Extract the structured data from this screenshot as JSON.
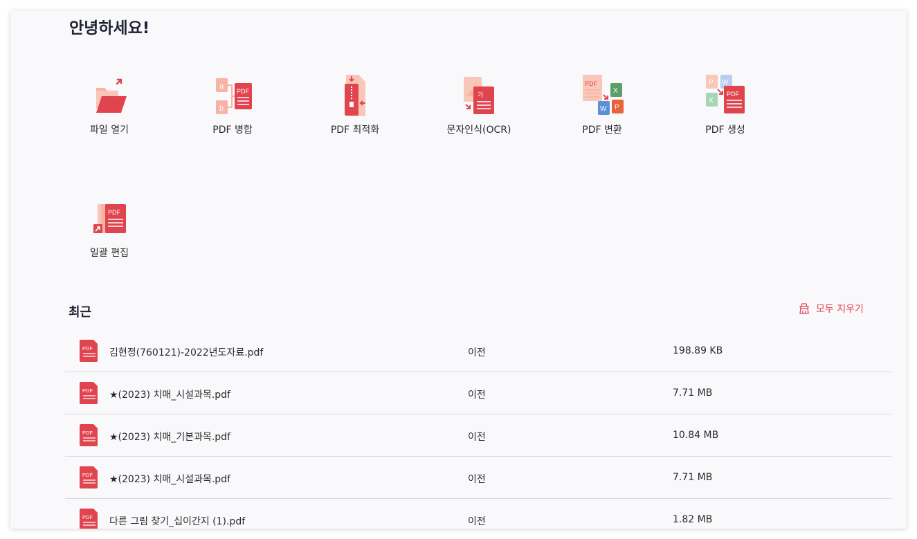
{
  "greeting": "안녕하세요!",
  "colors": {
    "accent": "#e0454f",
    "accent_light": "#f7b3a3",
    "text": "#2a2a2a"
  },
  "tools": [
    {
      "label": "파일 열기",
      "icon": "folder-open-icon"
    },
    {
      "label": "PDF 병합",
      "icon": "pdf-merge-icon"
    },
    {
      "label": "PDF 최적화",
      "icon": "pdf-compress-icon"
    },
    {
      "label": "문자인식(OCR)",
      "icon": "ocr-icon"
    },
    {
      "label": "PDF 변환",
      "icon": "pdf-convert-icon"
    },
    {
      "label": "PDF 생성",
      "icon": "pdf-create-icon"
    },
    {
      "label": "일괄 편집",
      "icon": "batch-edit-icon"
    }
  ],
  "recent": {
    "title": "최근",
    "clear_label": "모두 지우기",
    "files": [
      {
        "name": "김현정(760121)-2022년도자료.pdf",
        "date": "이전",
        "size": "198.89 KB"
      },
      {
        "name": "★(2023) 치매_시설과목.pdf",
        "date": "이전",
        "size": "7.71 MB"
      },
      {
        "name": "★(2023) 치매_기본과목.pdf",
        "date": "이전",
        "size": "10.84 MB"
      },
      {
        "name": "★(2023) 치매_시설과목.pdf",
        "date": "이전",
        "size": "7.71 MB"
      },
      {
        "name": "다른 그림 찾기_십이간지 (1).pdf",
        "date": "이전",
        "size": "1.82 MB"
      }
    ]
  },
  "pdf_icon_text": "PDF"
}
